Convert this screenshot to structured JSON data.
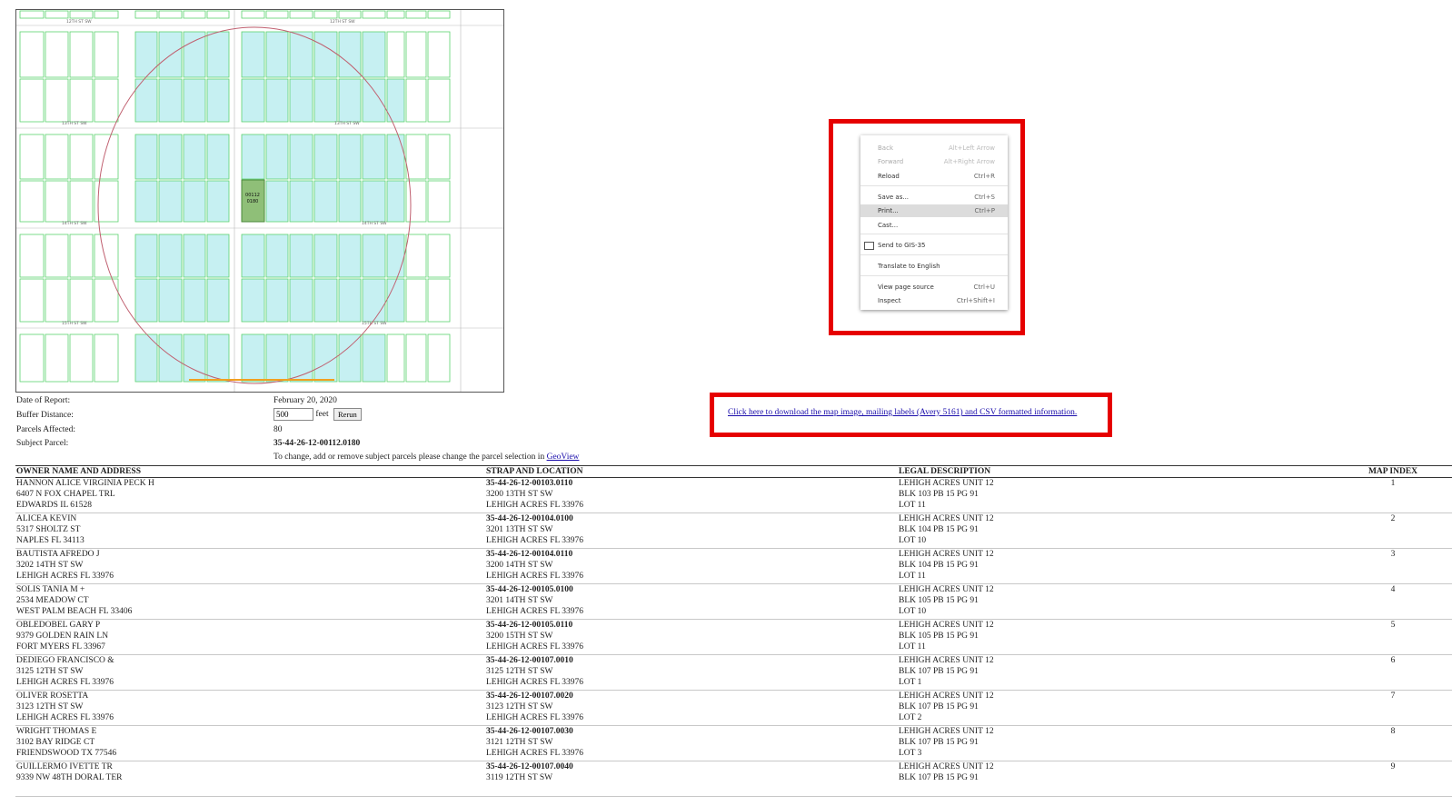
{
  "report": {
    "rows": [
      {
        "label": "Date of Report:",
        "value": "February 20, 2020"
      },
      {
        "label": "Buffer Distance:",
        "value": "500",
        "unit": "feet",
        "button": "Rerun"
      },
      {
        "label": "Parcels Affected:",
        "value": "80"
      },
      {
        "label": "Subject Parcel:",
        "value": "35-44-26-12-00112.0180"
      }
    ],
    "note": "To change, add or remove subject parcels please change the parcel selection in",
    "note_link": "GeoView"
  },
  "download": {
    "link_text": "Click here to download the map image, mailing labels (Avery 5161) and CSV formatted information."
  },
  "context_menu": {
    "items": [
      {
        "label": "Back",
        "shortcut": "Alt+Left Arrow",
        "disabled": true
      },
      {
        "label": "Forward",
        "shortcut": "Alt+Right Arrow",
        "disabled": true
      },
      {
        "label": "Reload",
        "shortcut": "Ctrl+R"
      },
      {
        "label": "Save as...",
        "shortcut": "Ctrl+S"
      },
      {
        "label": "Print...",
        "shortcut": "Ctrl+P",
        "highlighted": true
      },
      {
        "label": "Cast..."
      },
      {
        "label": "Send to GIS-35",
        "icon": "monitor-icon"
      },
      {
        "label": "Translate to English"
      },
      {
        "label": "View page source",
        "shortcut": "Ctrl+U"
      },
      {
        "label": "Inspect",
        "shortcut": "Ctrl+Shift+I"
      }
    ]
  },
  "map": {
    "street_labels": [
      "12TH ST SW",
      "13TH ST SW",
      "14TH ST SW",
      "15TH ST SW"
    ],
    "subject_parcel_label": [
      "00112",
      "0180"
    ]
  },
  "table": {
    "headers": [
      "OWNER NAME AND ADDRESS",
      "STRAP AND LOCATION",
      "LEGAL DESCRIPTION",
      "MAP INDEX"
    ],
    "rows": [
      {
        "owner": [
          "HANNON ALICE VIRGINIA PECK H",
          "6407 N FOX CHAPEL TRL",
          "EDWARDS IL 61528"
        ],
        "strap": [
          "35-44-26-12-00103.0110",
          "3200 13TH ST SW",
          "LEHIGH ACRES FL 33976"
        ],
        "legal": [
          "LEHIGH ACRES UNIT 12",
          "BLK 103 PB 15 PG 91",
          "LOT 11"
        ],
        "index": "1"
      },
      {
        "owner": [
          "ALICEA KEVIN",
          "5317 SHOLTZ ST",
          "NAPLES FL 34113"
        ],
        "strap": [
          "35-44-26-12-00104.0100",
          "3201 13TH ST SW",
          "LEHIGH ACRES FL 33976"
        ],
        "legal": [
          "LEHIGH ACRES UNIT 12",
          "BLK 104 PB 15 PG 91",
          "LOT 10"
        ],
        "index": "2"
      },
      {
        "owner": [
          "BAUTISTA AFREDO J",
          "3202 14TH ST SW",
          "LEHIGH ACRES FL 33976"
        ],
        "strap": [
          "35-44-26-12-00104.0110",
          "3200 14TH ST SW",
          "LEHIGH ACRES FL 33976"
        ],
        "legal": [
          "LEHIGH ACRES UNIT 12",
          "BLK 104 PB 15 PG 91",
          "LOT 11"
        ],
        "index": "3"
      },
      {
        "owner": [
          "SOLIS TANIA M +",
          "2534 MEADOW CT",
          "WEST PALM BEACH FL 33406"
        ],
        "strap": [
          "35-44-26-12-00105.0100",
          "3201 14TH ST SW",
          "LEHIGH ACRES FL 33976"
        ],
        "legal": [
          "LEHIGH ACRES UNIT 12",
          "BLK 105 PB 15 PG 91",
          "LOT 10"
        ],
        "index": "4"
      },
      {
        "owner": [
          "OBLEDOBEL GARY P",
          "9379 GOLDEN RAIN LN",
          "FORT MYERS FL 33967"
        ],
        "strap": [
          "35-44-26-12-00105.0110",
          "3200 15TH ST SW",
          "LEHIGH ACRES FL 33976"
        ],
        "legal": [
          "LEHIGH ACRES UNIT 12",
          "BLK 105 PB 15 PG 91",
          "LOT 11"
        ],
        "index": "5"
      },
      {
        "owner": [
          "DEDIEGO FRANCISCO &",
          "3125 12TH ST SW",
          "LEHIGH ACRES FL 33976"
        ],
        "strap": [
          "35-44-26-12-00107.0010",
          "3125 12TH ST SW",
          "LEHIGH ACRES FL 33976"
        ],
        "legal": [
          "LEHIGH ACRES UNIT 12",
          "BLK 107 PB 15 PG 91",
          "LOT 1"
        ],
        "index": "6"
      },
      {
        "owner": [
          "OLIVER ROSETTA",
          "3123 12TH ST SW",
          "LEHIGH ACRES FL 33976"
        ],
        "strap": [
          "35-44-26-12-00107.0020",
          "3123 12TH ST SW",
          "LEHIGH ACRES FL 33976"
        ],
        "legal": [
          "LEHIGH ACRES UNIT 12",
          "BLK 107 PB 15 PG 91",
          "LOT 2"
        ],
        "index": "7"
      },
      {
        "owner": [
          "WRIGHT THOMAS E",
          "3102 BAY RIDGE CT",
          "FRIENDSWOOD TX 77546"
        ],
        "strap": [
          "35-44-26-12-00107.0030",
          "3121 12TH ST SW",
          "LEHIGH ACRES FL 33976"
        ],
        "legal": [
          "LEHIGH ACRES UNIT 12",
          "BLK 107 PB 15 PG 91",
          "LOT 3"
        ],
        "index": "8"
      },
      {
        "owner": [
          "GUILLERMO IVETTE TR",
          "9339 NW 48TH DORAL TER"
        ],
        "strap": [
          "35-44-26-12-00107.0040",
          "3119 12TH ST SW"
        ],
        "legal": [
          "LEHIGH ACRES UNIT 12",
          "BLK 107 PB 15 PG 91"
        ],
        "index": "9"
      }
    ]
  }
}
